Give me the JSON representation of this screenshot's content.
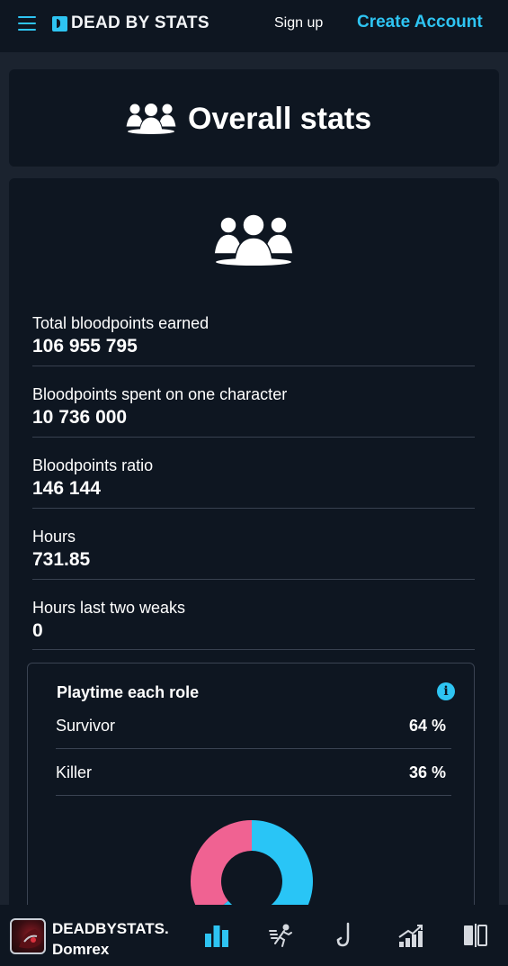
{
  "topbar": {
    "brand": "DEAD BY STATS",
    "sign_up": "Sign up",
    "create_account": "Create Account"
  },
  "header": {
    "title": "Overall stats"
  },
  "stats": [
    {
      "label": "Total bloodpoints earned",
      "value": "106 955 795"
    },
    {
      "label": "Bloodpoints spent on one character",
      "value": "10 736 000"
    },
    {
      "label": "Bloodpoints ratio",
      "value": "146 144"
    },
    {
      "label": "Hours",
      "value": "731.85"
    },
    {
      "label": "Hours last two weaks",
      "value": "0"
    }
  ],
  "playtime": {
    "title": "Playtime each role",
    "roles": [
      {
        "name": "Survivor",
        "percent": "64 %",
        "share": 64,
        "color": "#29c5f6"
      },
      {
        "name": "Killer",
        "percent": "36 %",
        "share": 36,
        "color": "#f06292"
      }
    ]
  },
  "bottombar": {
    "username_top": "DEADBYSTATS.",
    "username_bottom": "Domrex",
    "icons": [
      "bar-chart-icon",
      "survivor-run-icon",
      "killer-hook-icon",
      "progress-chart-icon",
      "compare-icon"
    ]
  },
  "colors": {
    "accent": "#2ec4f2",
    "background": "#1b232f",
    "card": "#0e1621"
  }
}
